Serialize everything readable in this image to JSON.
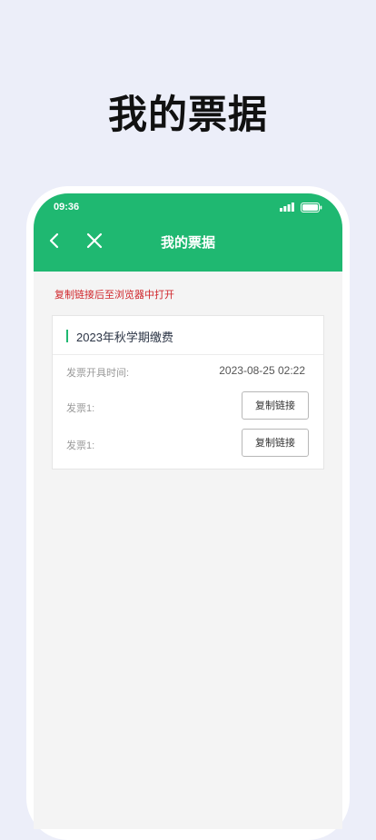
{
  "hero": {
    "title": "我的票据"
  },
  "status_bar": {
    "time": "09:36"
  },
  "app_bar": {
    "title": "我的票据"
  },
  "notice": "复制链接后至浏览器中打开",
  "invoice_card": {
    "title": "2023年秋学期缴费",
    "issue_time_label": "发票开具时间:",
    "issue_time_value": "2023-08-25 02:22",
    "invoices": [
      {
        "label": "发票1:",
        "button_label": "复制链接"
      },
      {
        "label": "发票1:",
        "button_label": "复制链接"
      }
    ]
  },
  "colors": {
    "accent": "#1fb871",
    "notice": "#d0262b",
    "background": "#eceef9"
  }
}
